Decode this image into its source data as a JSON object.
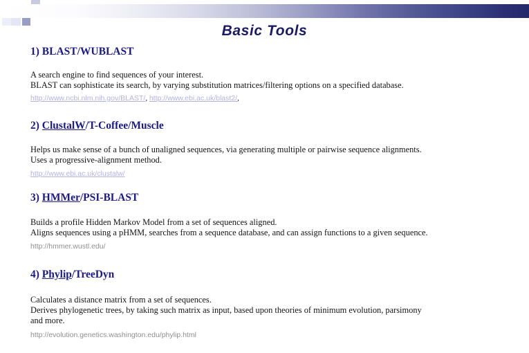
{
  "slide": {
    "title": "Basic Tools",
    "title_color": "#1a1a66",
    "heading_color": "#1a1a8c",
    "accent_dark": "#232868",
    "accent_mid": "#9a9dc4",
    "accent_light": "#c8cae4",
    "url_lavender_color": "#b3b3e0",
    "url_gray_color": "#909090"
  },
  "sections": [
    {
      "number": "1)",
      "link_label": "",
      "rest_label": "BLAST/WUBLAST",
      "lines": [
        "A search engine to find sequences of your interest.",
        "BLAST can sophisticate its search, by varying substitution matrices/filtering options on a specified database."
      ],
      "urls": [
        "http://www.ncbi.nlm.nih.gov/BLAST/",
        "http://www.ebi.ac.uk/blast2/"
      ],
      "url_style": "lavender",
      "url_separator": ", ",
      "url_trailing": ","
    },
    {
      "number": "2)",
      "link_label": "ClustalW",
      "rest_label": "/T-Coffee/Muscle",
      "lines": [
        " Helps us make sense of a bunch of unaligned sequences, via generating multiple or  pairwise sequence alignments.",
        " Uses a progressive-alignment method."
      ],
      "urls": [
        "http://www.ebi.ac.uk/clustalw/"
      ],
      "url_style": "lavender",
      "url_separator": "",
      "url_trailing": ""
    },
    {
      "number": "3)",
      "link_label": "HMMer",
      "rest_label": "/PSI-BLAST",
      "lines": [
        "Builds a profile Hidden Markov Model from a set of sequences aligned.",
        "Aligns sequences using a pHMM, searches from a sequence database, and can assign functions  to a given sequence."
      ],
      "urls": [
        "http://hmmer.wustl.edu/"
      ],
      "url_style": "gray",
      "url_separator": "",
      "url_trailing": ""
    },
    {
      "number": "4)",
      "link_label": "Phylip",
      "rest_label": "/TreeDyn",
      "lines": [
        "Calculates a distance matrix from a set of sequences.",
        "Derives phylogenetic trees, by taking such matrix as input, based upon theories of minimum evolution, parsimony",
        " and more."
      ],
      "urls": [
        "http://evolution.genetics.washington.edu/phylip.html"
      ],
      "url_style": "gray",
      "url_separator": "",
      "url_trailing": ""
    }
  ]
}
